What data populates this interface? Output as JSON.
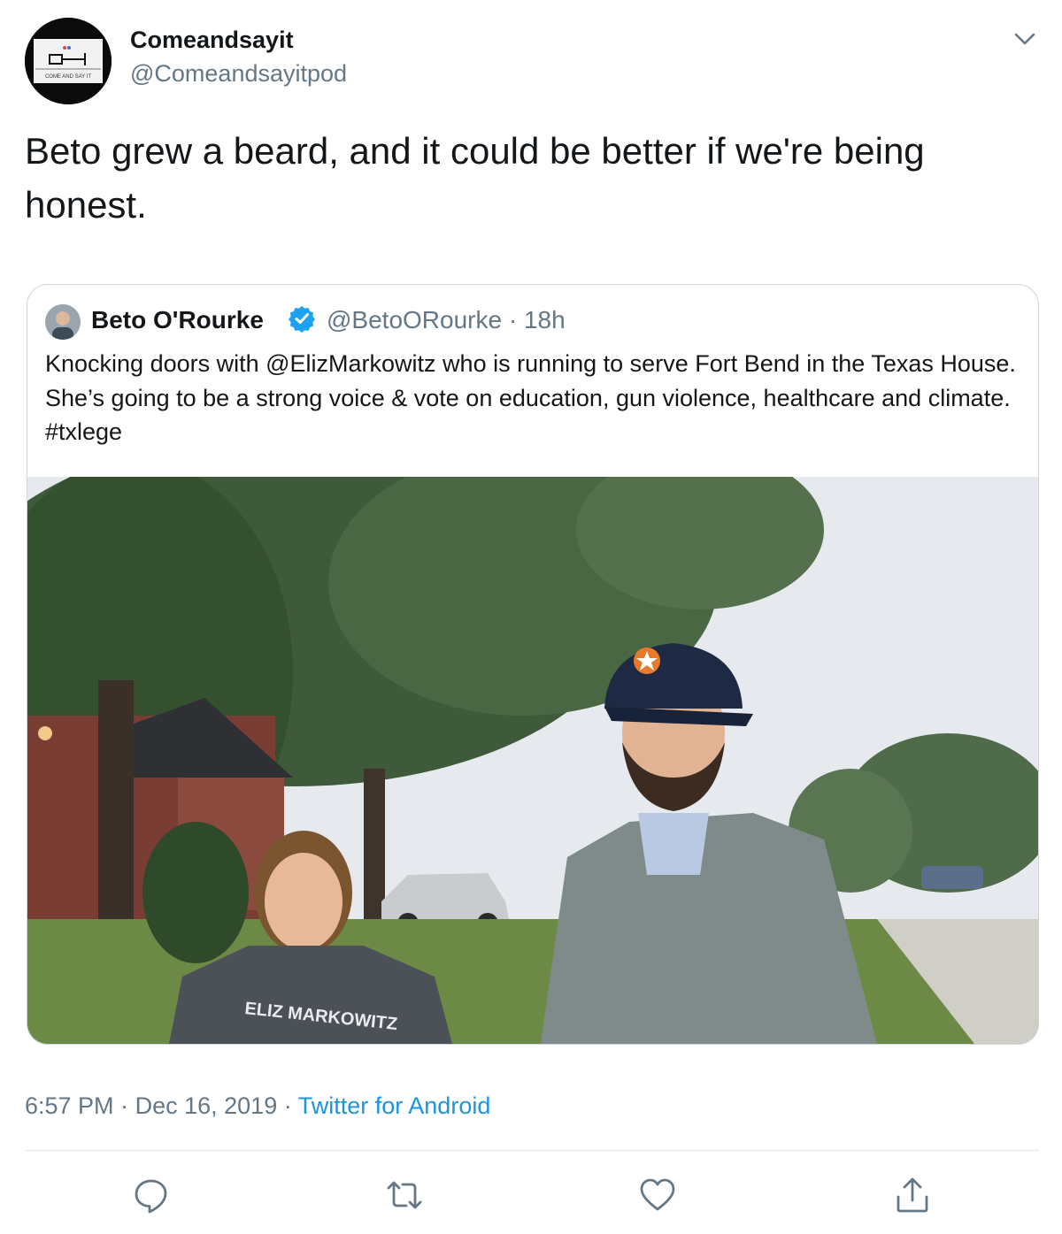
{
  "author": {
    "display_name": "Comeandsayit",
    "handle": "@Comeandsayitpod",
    "avatar_caption": "COME AND SAY IT"
  },
  "tweet": {
    "text": "Beto grew a beard, and it could be better if we're being honest."
  },
  "quoted_tweet": {
    "display_name": "Beto O'Rourke",
    "verified": true,
    "handle": "@BetoORourke",
    "separator": "·",
    "age": "18h",
    "text": "Knocking doors with @ElizMarkowitz who is running to serve Fort Bend in the Texas House. She’s going to be a strong voice & vote on education, gun violence, healthcare and climate. #txlege",
    "photo": {
      "shirt_text": "ELIZ MARKOWITZ"
    }
  },
  "footer": {
    "time": "6:57 PM",
    "separator": "·",
    "date": "Dec 16, 2019",
    "source": "Twitter for Android"
  },
  "actions": [
    {
      "name": "reply-icon"
    },
    {
      "name": "retweet-icon"
    },
    {
      "name": "like-icon"
    },
    {
      "name": "share-icon"
    }
  ],
  "colors": {
    "accent": "#1b95e0",
    "secondary_text": "#657786",
    "border": "#ccd6dd",
    "verified": "#1da1f2"
  }
}
